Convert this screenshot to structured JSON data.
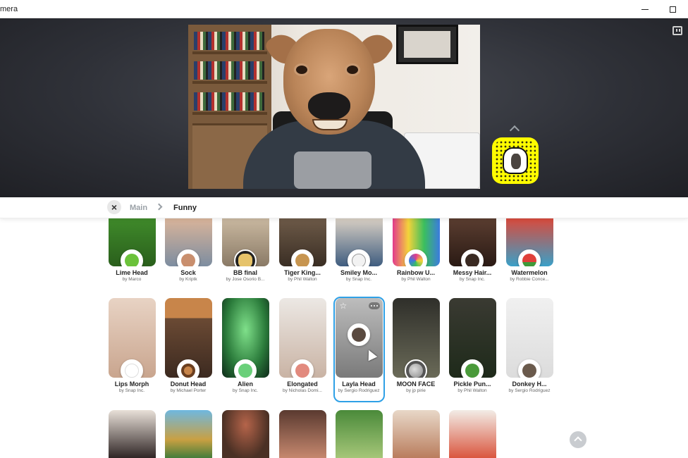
{
  "window": {
    "title": "mera",
    "minimize_icon": "minimize-icon",
    "maximize_icon": "maximize-icon"
  },
  "preview": {
    "chat_icon": "twitch-chat-icon",
    "expand_icon": "chevron-up-icon",
    "snapcode_icon": "snapcode-icon",
    "snapcode_color": "#fffc00"
  },
  "breadcrumb": {
    "close_icon": "×",
    "main": "Main",
    "current": "Funny"
  },
  "accent_color": "#2ea0e6",
  "lenses_row1": [
    {
      "name": "Lime Head",
      "author": "by Marco"
    },
    {
      "name": "Sock",
      "author": "by Kriptk"
    },
    {
      "name": "BB final",
      "author": "by Jose Osorio B..."
    },
    {
      "name": "Tiger King...",
      "author": "by Phil Walton"
    },
    {
      "name": "Smiley Mo...",
      "author": "by Snap Inc."
    },
    {
      "name": "Rainbow U...",
      "author": "by Phil Walton"
    },
    {
      "name": "Messy Hair...",
      "author": "by Snap Inc."
    },
    {
      "name": "Watermelon",
      "author": "by Robbie Conce..."
    }
  ],
  "lenses_row2": [
    {
      "name": "Lips Morph",
      "author": "by Snap Inc."
    },
    {
      "name": "Donut Head",
      "author": "by Michael Porter"
    },
    {
      "name": "Alien",
      "author": "by Snap Inc."
    },
    {
      "name": "Elongated",
      "author": "by Nicholas Domi..."
    },
    {
      "name": "Layla Head",
      "author": "by Sergio Rodriguez"
    },
    {
      "name": "MOON FACE",
      "author": "by jp pirie"
    },
    {
      "name": "Pickle Pun...",
      "author": "by Phil Walton"
    },
    {
      "name": "Donkey H...",
      "author": "by Sergio Rodriguez"
    }
  ]
}
